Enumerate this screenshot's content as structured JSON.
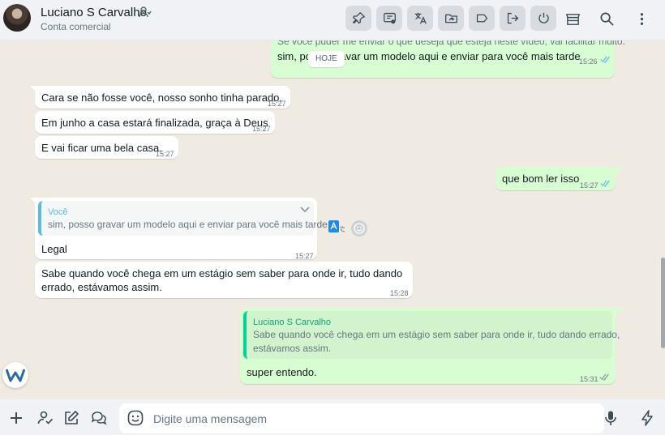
{
  "header": {
    "contact_name": "Luciano S Carvalho",
    "contact_subtitle": "Conta comercial"
  },
  "toolbar": [
    {
      "icon": "pin-icon"
    },
    {
      "icon": "message-status-icon"
    },
    {
      "icon": "translate-icon"
    },
    {
      "icon": "folder-share-icon"
    },
    {
      "icon": "label-icon"
    },
    {
      "icon": "exit-icon"
    },
    {
      "icon": "power-icon"
    },
    {
      "icon": "store-icon"
    },
    {
      "icon": "search-icon"
    },
    {
      "icon": "more-vertical-icon"
    }
  ],
  "chat": {
    "date_divider": "HOJE",
    "messages": [
      {
        "id": "m0",
        "direction": "out",
        "text_top": "Se você puder me enviar o que deseja que esteja neste vídeo, vai facilitar muito.",
        "text": "sim, posso gravar um modelo aqui e enviar para você mais tarde",
        "time": "15:26",
        "status": "read"
      },
      {
        "id": "m1",
        "direction": "in",
        "text": "Cara se não fosse você, nosso sonho tinha parado.",
        "time": "15:27"
      },
      {
        "id": "m2",
        "direction": "in",
        "text": "Em junho a casa estará finalizada, graça à Deus",
        "time": "15:27"
      },
      {
        "id": "m3",
        "direction": "in",
        "text": "E vai ficar uma bela casa.",
        "time": "15:27"
      },
      {
        "id": "m4",
        "direction": "out",
        "text": "que bom ler isso",
        "time": "15:27",
        "status": "read"
      },
      {
        "id": "m5",
        "direction": "in",
        "quote_author": "Você",
        "quote_text": "sim, posso gravar um modelo aqui e enviar para você mais tarde",
        "text": "Legal",
        "time": "15:27"
      },
      {
        "id": "m6",
        "direction": "in",
        "text_line1": "Sabe quando você chega em um estágio sem saber para onde ir, tudo dando",
        "text_line2": "errado, estávamos assim.",
        "time": "15:28"
      },
      {
        "id": "m7",
        "direction": "out",
        "quote_author": "Luciano S Carvalho",
        "quote_line1": "Sabe quando você chega em um estágio sem saber para onde ir, tudo dando errado,",
        "quote_line2": "estávamos assim.",
        "text": "super entendo.",
        "time": "15:31",
        "status": "read"
      }
    ]
  },
  "composer": {
    "placeholder": "Digite uma mensagem",
    "value": ""
  },
  "colors": {
    "accent": "#00a884",
    "outgoing_bubble": "#d9fdd3",
    "incoming_bubble": "#ffffff",
    "read_tick": "#53bdeb",
    "chat_background": "#efeae2"
  }
}
